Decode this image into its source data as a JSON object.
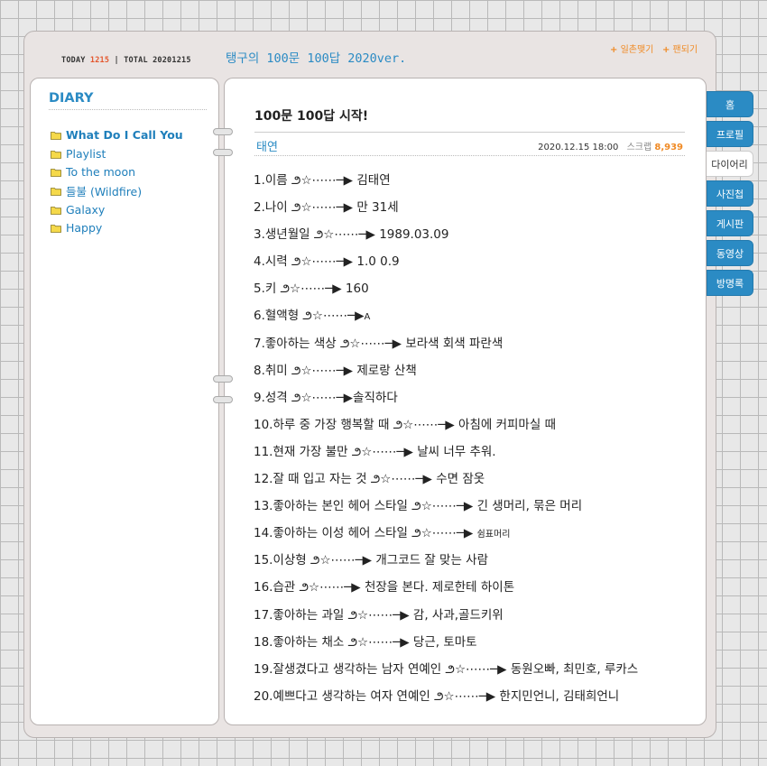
{
  "header": {
    "today_label": "TODAY",
    "today_count": "1215",
    "separator": "|",
    "total_label": "TOTAL",
    "total_count": "20201215",
    "site_title": "탱구의 100문 100답 2020ver.",
    "link1_plus": "+",
    "link1_label": "일촌맺기",
    "link2_plus": "+",
    "link2_label": "팬되기",
    "link_color": "#f08a24"
  },
  "sidebar": {
    "title": "DIARY",
    "items": [
      {
        "label": "What Do I Call You",
        "icon": "folder-icon"
      },
      {
        "label": "Playlist",
        "icon": "folder-icon"
      },
      {
        "label": "To the moon",
        "icon": "folder-icon"
      },
      {
        "label": "들불 (Wildfire)",
        "icon": "folder-icon"
      },
      {
        "label": "Galaxy",
        "icon": "folder-icon"
      },
      {
        "label": "Happy",
        "icon": "folder-icon"
      }
    ]
  },
  "post": {
    "title": "100문 100답 시작!",
    "author": "태연",
    "datetime": "2020.12.15 18:00",
    "scrap_label": "스크랩",
    "scrap_count": "8,939",
    "items": [
      "1.이름 ౨☆⋯⋯─▶ 김태연",
      "2.나이 ౨☆⋯⋯─▶ 만 31세",
      "3.생년월일 ౨☆⋯⋯─▶ 1989.03.09",
      "4.시력 ౨☆⋯⋯─▶ 1.0 0.9",
      "5.키 ౨☆⋯⋯─▶ 160",
      "6.혈액형 ౨☆⋯⋯─▶",
      "7.좋아하는 색상 ౨☆⋯⋯─▶ 보라색 회색 파란색",
      "8.취미 ౨☆⋯⋯─▶ 제로랑 산책",
      "9.성격 ౨☆⋯⋯─▶솔직하다",
      "10.하루 중 가장 행복할 때 ౨☆⋯⋯─▶ 아침에 커피마실 때",
      "11.현재 가장 불만 ౨☆⋯⋯─▶ 날씨 너무 추워.",
      "12.잘 때 입고 자는 것 ౨☆⋯⋯─▶ 수면 잠옷",
      "13.좋아하는 본인 헤어 스타일 ౨☆⋯⋯─▶ 긴 생머리, 묶은 머리",
      "14.좋아하는 이성 헤어 스타일 ౨☆⋯⋯─▶",
      "15.이상형 ౨☆⋯⋯─▶ 개그코드 잘 맞는 사람",
      "16.습관 ౨☆⋯⋯─▶  천장을 본다.  제로한테 하이톤",
      "17.좋아하는 과일 ౨☆⋯⋯─▶ 감, 사과,골드키위",
      "18.좋아하는 채소 ౨☆⋯⋯─▶ 당근, 토마토",
      "19.잘생겼다고 생각하는 남자 연예인 ౨☆⋯⋯─▶ 동원오빠, 최민호, 루카스",
      "20.예쁘다고 생각하는 여자 연예인 ౨☆⋯⋯─▶ 한지민언니, 김태희언니"
    ],
    "item6_small": "A",
    "item14_small": "쉼표머리"
  },
  "tabs": [
    {
      "label": "홈",
      "active": false
    },
    {
      "label": "프로필",
      "active": false
    },
    {
      "label": "다이어리",
      "active": true
    },
    {
      "label": "사진첩",
      "active": false
    },
    {
      "label": "게시판",
      "active": false
    },
    {
      "label": "동영상",
      "active": false
    },
    {
      "label": "방명록",
      "active": false
    }
  ],
  "colors": {
    "accent": "#2b8bc4",
    "counter_red": "#e4572e",
    "folder": "#f5d94a"
  }
}
